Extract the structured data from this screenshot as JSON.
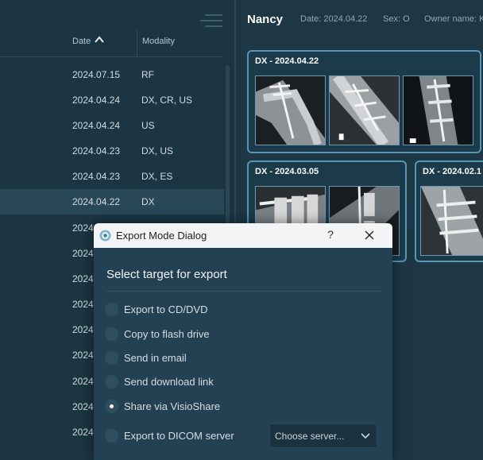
{
  "list": {
    "columns": {
      "date": "Date",
      "modality": "Modality"
    },
    "rows": [
      {
        "date": "2024.07.15",
        "modality": "RF"
      },
      {
        "date": "2024.04.24",
        "modality": "DX, CR, US"
      },
      {
        "date": "2024.04.24",
        "modality": "US"
      },
      {
        "date": "2024.04.23",
        "modality": "DX, US"
      },
      {
        "date": "2024.04.23",
        "modality": "DX, ES"
      },
      {
        "date": "2024.04.22",
        "modality": "DX"
      },
      {
        "date": "2024.",
        "modality": ""
      },
      {
        "date": "2024.",
        "modality": ""
      },
      {
        "date": "2024.",
        "modality": ""
      },
      {
        "date": "2024.",
        "modality": ""
      },
      {
        "date": "2024.",
        "modality": ""
      },
      {
        "date": "2024.",
        "modality": ""
      },
      {
        "date": "2024.",
        "modality": ""
      },
      {
        "date": "2024.",
        "modality": ""
      },
      {
        "date": "2024.",
        "modality": ""
      }
    ],
    "selected_index": 5
  },
  "patient": {
    "name": "Nancy",
    "date": "Date: 2024.04.22",
    "sex": "Sex: O",
    "owner": "Owner name: K"
  },
  "studies": [
    {
      "title": "DX - 2024.04.22"
    },
    {
      "title": "DX - 2024.03.05"
    },
    {
      "title": "DX - 2024.02.1"
    }
  ],
  "dialog": {
    "title": "Export Mode Dialog",
    "help": "?",
    "heading": "Select target for export",
    "options": [
      {
        "label": "Export to CD/DVD"
      },
      {
        "label": "Copy to flash drive"
      },
      {
        "label": "Send in email"
      },
      {
        "label": "Send download link"
      },
      {
        "label": "Share via VisioShare"
      },
      {
        "label": "Export to DICOM server"
      }
    ],
    "selected_option": "Share via VisioShare",
    "server_select": "Choose server..."
  },
  "colors": {
    "background": "#1d3440",
    "accent_border": "#5b95b6",
    "selected_row": "#284857"
  }
}
